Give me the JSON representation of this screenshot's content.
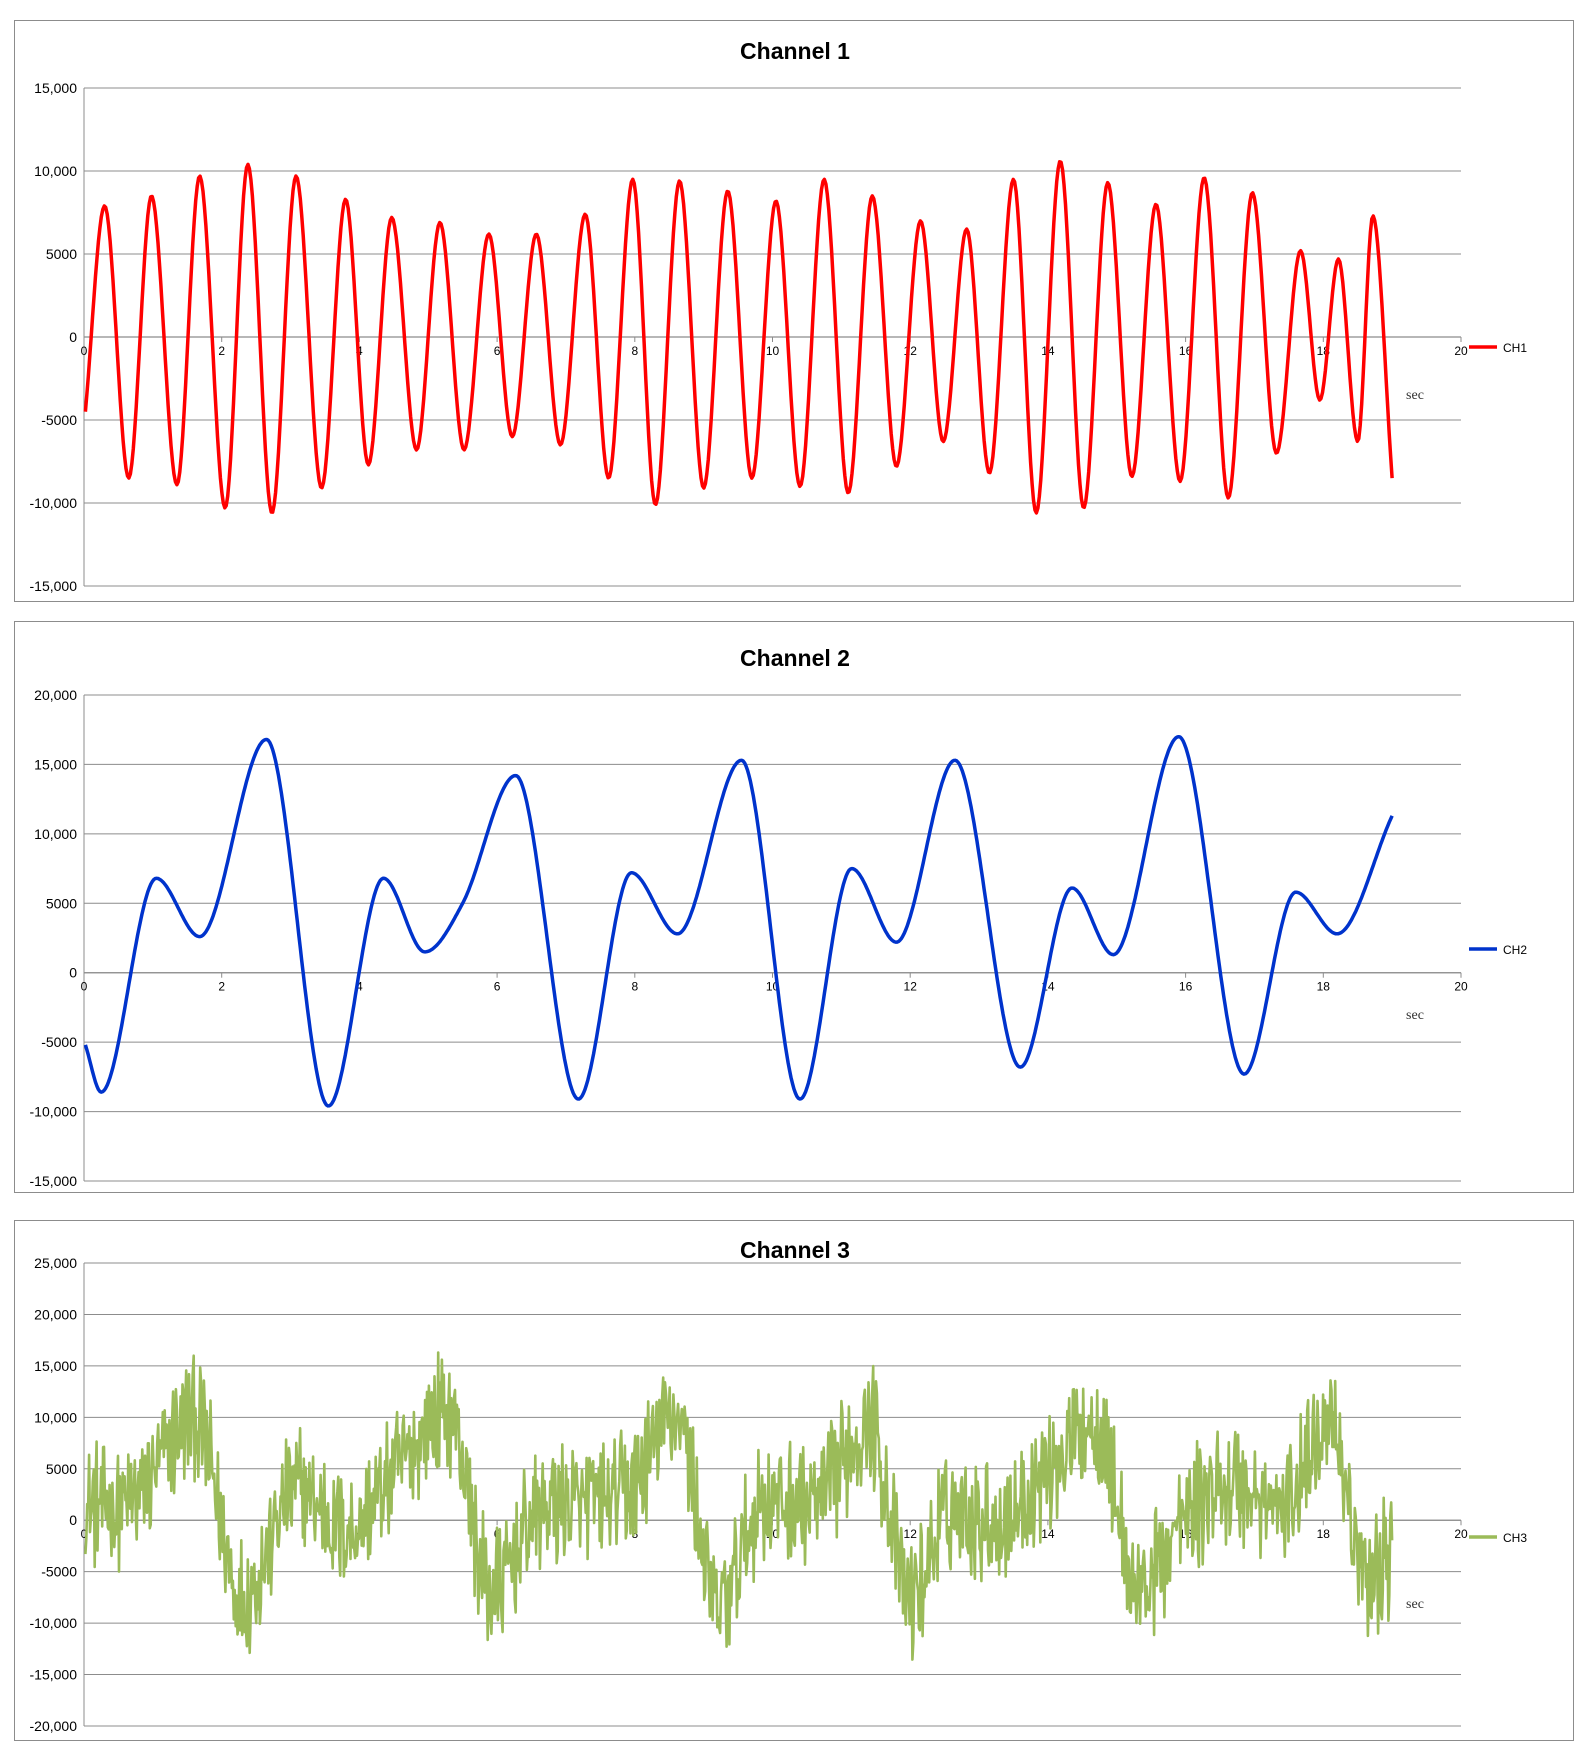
{
  "chart_data": [
    {
      "type": "line",
      "title": "Channel 1",
      "xlabel": "sec",
      "ylabel": "",
      "xlim": [
        0,
        20
      ],
      "ylim": [
        -15000,
        15000
      ],
      "x_ticks": [
        "0",
        "2",
        "4",
        "6",
        "8",
        "10",
        "12",
        "14",
        "16",
        "18",
        "20"
      ],
      "y_ticks": [
        "15,000",
        "10,000",
        "5000",
        "0",
        "-5000",
        "-10,000",
        "-15,000"
      ],
      "grid": true,
      "legend": "right",
      "series": [
        {
          "name": "CH1",
          "color": "#ff0000",
          "x": [
            0.02,
            0.3,
            0.65,
            0.98,
            1.35,
            1.68,
            2.05,
            2.38,
            2.73,
            3.08,
            3.45,
            3.8,
            4.13,
            4.47,
            4.83,
            5.17,
            5.52,
            5.88,
            6.22,
            6.57,
            6.92,
            7.28,
            7.62,
            7.97,
            8.3,
            8.65,
            9.0,
            9.35,
            9.7,
            10.05,
            10.4,
            10.75,
            11.1,
            11.45,
            11.8,
            12.15,
            12.48,
            12.82,
            13.15,
            13.5,
            13.83,
            14.18,
            14.52,
            14.87,
            15.22,
            15.57,
            15.92,
            16.27,
            16.62,
            16.97,
            17.32,
            17.67,
            17.95,
            18.22,
            18.5,
            18.72,
            19.0
          ],
          "y": [
            -4500,
            7900,
            -8500,
            8500,
            -8900,
            9700,
            -10300,
            10400,
            -10600,
            9700,
            -9100,
            8300,
            -7700,
            7200,
            -6800,
            6900,
            -6800,
            6200,
            -6000,
            6200,
            -6500,
            7400,
            -8500,
            9500,
            -10100,
            9400,
            -9100,
            8800,
            -8500,
            8200,
            -9000,
            9500,
            -9400,
            8500,
            -7800,
            7000,
            -6300,
            6500,
            -8200,
            9500,
            -10600,
            10600,
            -10300,
            9300,
            -8400,
            8000,
            -8700,
            9600,
            -9700,
            8700,
            -7000,
            5200,
            -3800,
            4700,
            -6300,
            7300,
            -8500
          ]
        }
      ]
    },
    {
      "type": "line",
      "title": "Channel 2",
      "xlabel": "sec",
      "ylabel": "",
      "xlim": [
        0,
        20
      ],
      "ylim": [
        -15000,
        20000
      ],
      "x_ticks": [
        "0",
        "2",
        "4",
        "6",
        "8",
        "10",
        "12",
        "14",
        "16",
        "18",
        "20"
      ],
      "y_ticks": [
        "20,000",
        "15,000",
        "10,000",
        "5000",
        "0",
        "-5000",
        "-10,000",
        "-15,000"
      ],
      "grid": true,
      "legend": "right",
      "series": [
        {
          "name": "CH2",
          "color": "#0033cc",
          "x": [
            0.02,
            0.25,
            1.05,
            1.68,
            2.65,
            3.55,
            4.35,
            4.95,
            5.5,
            6.27,
            7.18,
            7.95,
            8.62,
            9.55,
            10.4,
            11.15,
            11.8,
            12.65,
            13.6,
            14.35,
            14.95,
            15.9,
            16.85,
            17.6,
            18.2,
            19.0
          ],
          "y": [
            -5200,
            -8600,
            6800,
            2600,
            16800,
            -9600,
            6800,
            1500,
            5000,
            14200,
            -9100,
            7200,
            2800,
            15300,
            -9100,
            7500,
            2200,
            15300,
            -6800,
            6100,
            1300,
            17000,
            -7300,
            5800,
            2800,
            11300
          ]
        }
      ]
    },
    {
      "type": "line",
      "title": "Channel 3",
      "xlabel": "sec",
      "ylabel": "",
      "xlim": [
        0,
        20
      ],
      "ylim": [
        -20000,
        25000
      ],
      "x_ticks": [
        "0",
        "2",
        "4",
        "6",
        "8",
        "10",
        "12",
        "14",
        "16",
        "18",
        "20"
      ],
      "y_ticks": [
        "25,000",
        "20,000",
        "15,000",
        "10,000",
        "5000",
        "0",
        "-5000",
        "-10,000",
        "-15,000",
        "-20,000"
      ],
      "grid": true,
      "legend": "right",
      "series": [
        {
          "name": "CH3",
          "color": "#9bbb59",
          "x": [
            0.02,
            0.75,
            1.6,
            2.3,
            3.1,
            3.8,
            4.6,
            5.3,
            5.9,
            6.6,
            7.3,
            8.0,
            8.6,
            9.2,
            9.9,
            10.6,
            11.4,
            12.0,
            12.6,
            13.3,
            14.0,
            14.7,
            15.3,
            16.0,
            16.7,
            17.4,
            18.1,
            18.6,
            19.0
          ],
          "y": [
            1500,
            2000,
            10000,
            -7500,
            3000,
            -1000,
            5500,
            10500,
            -7000,
            1000,
            1500,
            3500,
            10500,
            -8500,
            2000,
            1500,
            9500,
            -7500,
            1000,
            0,
            5000,
            9500,
            -6500,
            0,
            3500,
            1000,
            10500,
            -5500,
            -3000
          ],
          "noise_amplitude": 5000
        }
      ]
    }
  ]
}
